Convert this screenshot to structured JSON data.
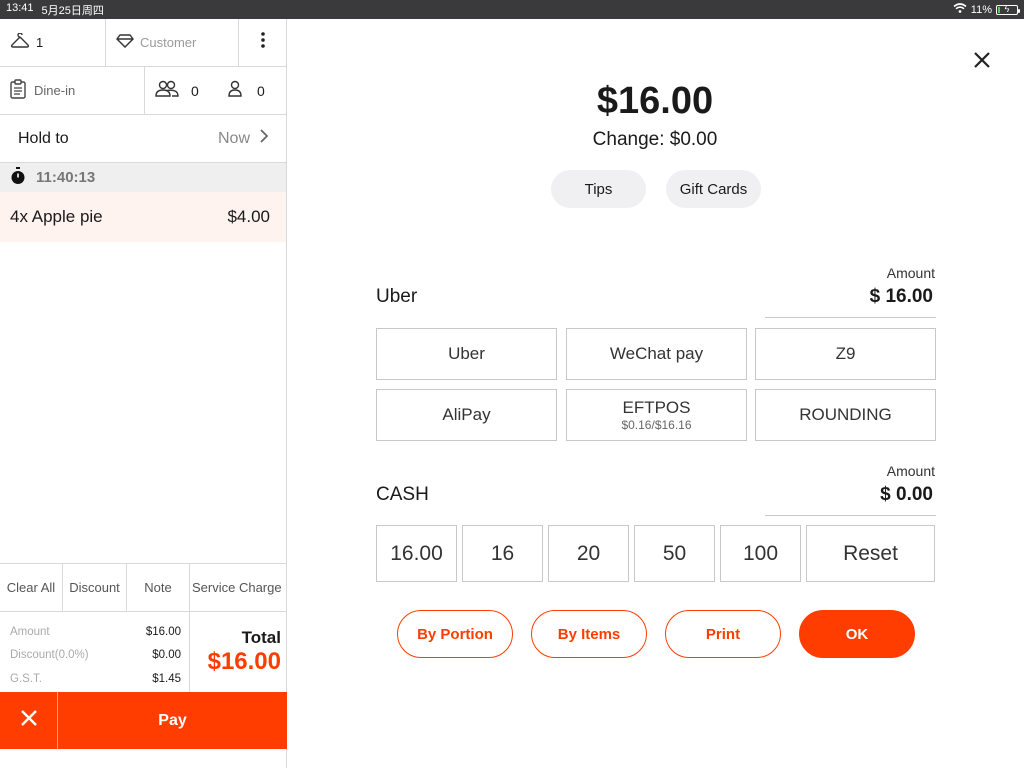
{
  "status_bar": {
    "time": "13:41",
    "date": "5月25日周四",
    "battery": "11%",
    "battery_level": 0.11
  },
  "order_header": {
    "guest_count": "1",
    "customer_placeholder": "Customer",
    "order_type": "Dine-in",
    "adults": "0",
    "children": "0",
    "hold_to_label": "Hold to",
    "hold_to_value": "Now"
  },
  "order": {
    "time": "11:40:13",
    "items": [
      {
        "name": "4x Apple pie",
        "price": "$4.00"
      }
    ]
  },
  "actions": {
    "clear_all": "Clear All",
    "discount": "Discount",
    "note": "Note",
    "service_charge": "Service Charge"
  },
  "summary": {
    "lines": [
      {
        "label": "Amount",
        "value": "$16.00"
      },
      {
        "label": "Discount(0.0%)",
        "value": "$0.00"
      },
      {
        "label": "G.S.T.",
        "value": "$1.45"
      }
    ],
    "total_label": "Total",
    "total_value": "$16.00"
  },
  "pay_bar": {
    "pay_label": "Pay"
  },
  "payment": {
    "total": "$16.00",
    "change": "Change: $0.00",
    "tips": "Tips",
    "gift_cards": "Gift Cards",
    "amount_label": "Amount",
    "selected_method": "Uber",
    "selected_amount": "$ 16.00",
    "methods": [
      {
        "label": "Uber",
        "sub": ""
      },
      {
        "label": "WeChat pay",
        "sub": ""
      },
      {
        "label": "Z9",
        "sub": ""
      },
      {
        "label": "AliPay",
        "sub": ""
      },
      {
        "label": "EFTPOS",
        "sub": "$0.16/$16.16"
      },
      {
        "label": "ROUNDING",
        "sub": ""
      }
    ],
    "cash_label": "CASH",
    "cash_amount": "$ 0.00",
    "cash_quick": [
      "16.00",
      "16",
      "20",
      "50",
      "100"
    ],
    "reset": "Reset",
    "by_portion": "By Portion",
    "by_items": "By Items",
    "print": "Print",
    "ok": "OK"
  },
  "colors": {
    "accent": "#ff3d00",
    "item_highlight": "#fff3f0",
    "pill_bg": "#f0f0f2"
  }
}
